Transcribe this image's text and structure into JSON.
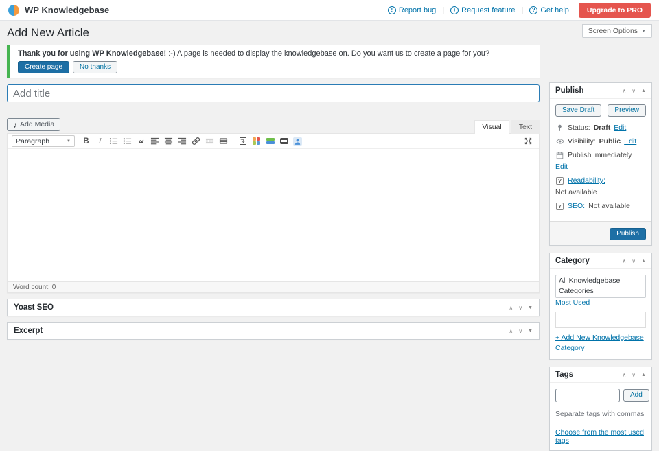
{
  "topbar": {
    "brand": "WP Knowledgebase",
    "separator": "|",
    "links": [
      {
        "label": "Report bug"
      },
      {
        "label": "Request feature"
      },
      {
        "label": "Get help"
      }
    ],
    "upgrade_label": "Upgrade to PRO"
  },
  "page": {
    "title": "Add New Article",
    "screen_options_label": "Screen Options"
  },
  "notice": {
    "bold_text": "Thank you for using WP Knowledgebase!",
    "text": ":-) A page is needed to display the knowledgebase on. Do you want us to create a page for you?",
    "create_button": "Create page",
    "dismiss_button": "No thanks"
  },
  "title_input": {
    "placeholder": "Add title"
  },
  "editor": {
    "add_media_label": "Add Media",
    "tabs": {
      "visual": "Visual",
      "text": "Text"
    },
    "paragraph_label": "Paragraph",
    "word_count_label": "Word count:",
    "word_count_value": "0"
  },
  "panels": {
    "yoast": {
      "title": "Yoast SEO"
    },
    "excerpt": {
      "title": "Excerpt"
    }
  },
  "publish": {
    "title": "Publish",
    "save_draft": "Save Draft",
    "preview": "Preview",
    "status_label": "Status:",
    "status_value": "Draft",
    "visibility_label": "Visibility:",
    "visibility_value": "Public",
    "schedule_label": "Publish immediately",
    "edit": "Edit",
    "readability_label": "Readability:",
    "readability_value": "Not available",
    "seo_label": "SEO:",
    "seo_value": "Not available",
    "publish_button": "Publish"
  },
  "category": {
    "title": "Category",
    "tab_all": "All Knowledgebase Categories",
    "tab_most_used": "Most Used",
    "add_new": "+ Add New Knowledgebase Category"
  },
  "tags": {
    "title": "Tags",
    "add_button": "Add",
    "hint": "Separate tags with commas",
    "choose_link": "Choose from the most used tags"
  },
  "icons": {
    "bug": "!",
    "feature": "+",
    "help": "?",
    "media": "♪",
    "bold": "B",
    "italic": "I",
    "blockquote": "“",
    "dfw": "⇅",
    "up_arrow": "∧",
    "down_arrow": "∨",
    "toggle_open": "▲",
    "toggle_closed": "▼",
    "select_arrow": "▼"
  },
  "colors": {
    "link_blue": "#0073aa",
    "primary_button_blue": "#1d6fa5",
    "upgrade_red": "#e5554e",
    "notice_green": "#46b450",
    "page_background": "#f1f1f1"
  }
}
